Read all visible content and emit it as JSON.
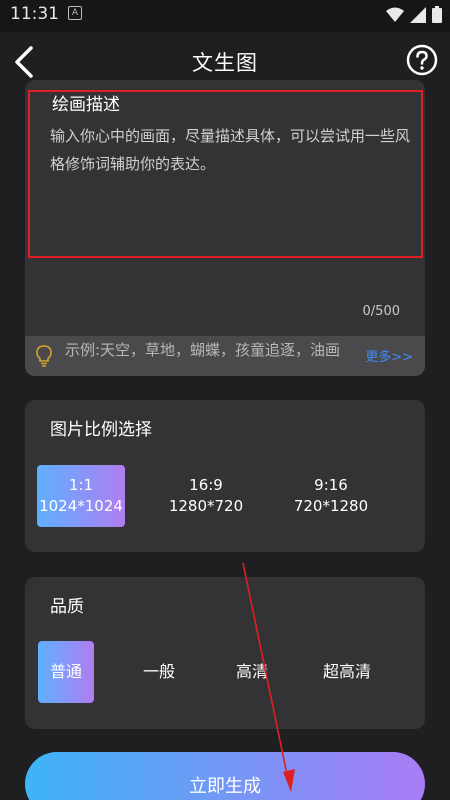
{
  "status_bar": {
    "time": "11:31",
    "notification_letter": "A",
    "icons": [
      "wifi-icon",
      "signal-icon",
      "battery-icon"
    ]
  },
  "header": {
    "title": "文生图",
    "back_icon": "chevron-left-icon",
    "help_icon": "question-circle-icon"
  },
  "description": {
    "label": "绘画描述",
    "placeholder": "输入你心中的画面，尽量描述具体，可以尝试用一些风格修饰词辅助你的表达。",
    "value": "",
    "counter": "0/500",
    "example_text": "示例:天空，草地，蝴蝶，孩童追逐，油画",
    "more_label": "更多>>",
    "bulb_icon": "lightbulb-icon"
  },
  "ratio": {
    "title": "图片比例选择",
    "options": [
      {
        "ratio": "1:1",
        "size": "1024*1024",
        "selected": true
      },
      {
        "ratio": "16:9",
        "size": "1280*720",
        "selected": false
      },
      {
        "ratio": "9:16",
        "size": "720*1280",
        "selected": false
      }
    ]
  },
  "quality": {
    "title": "品质",
    "options": [
      {
        "label": "普通",
        "selected": true
      },
      {
        "label": "一般",
        "selected": false
      },
      {
        "label": "高清",
        "selected": false
      },
      {
        "label": "超高清",
        "selected": false
      }
    ]
  },
  "generate": {
    "label": "立即生成"
  },
  "colors": {
    "background": "#1f1f21",
    "card": "#333336",
    "accent_start": "#3cb4f5",
    "accent_end": "#a97cf5",
    "highlight_border": "#e02020",
    "link": "#3d8df5"
  }
}
